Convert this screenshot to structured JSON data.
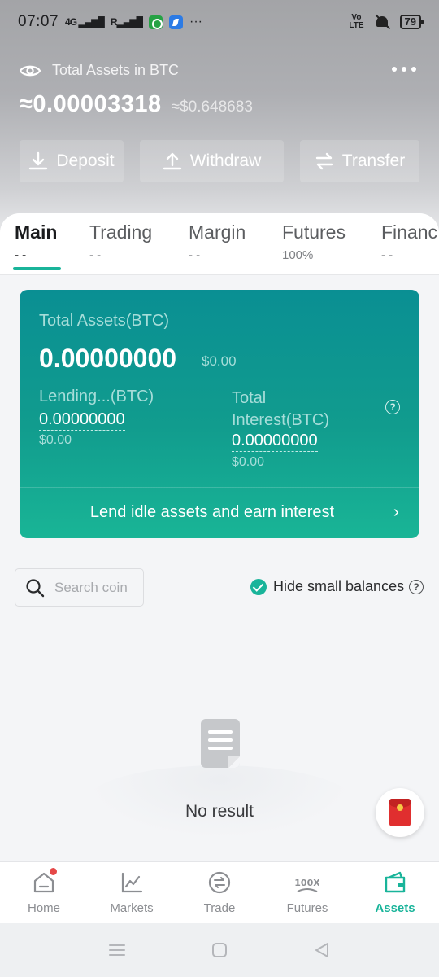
{
  "status_bar": {
    "time": "07:07",
    "signal1": "4G",
    "signal2": "R",
    "more": "···",
    "volte": "Vo LTE",
    "battery": "79"
  },
  "header": {
    "label": "Total Assets in BTC",
    "balance_btc": "≈0.00003318",
    "balance_usd": "≈$0.648683",
    "actions": [
      {
        "label": "Deposit",
        "icon": "download-icon"
      },
      {
        "label": "Withdraw",
        "icon": "upload-icon"
      },
      {
        "label": "Transfer",
        "icon": "transfer-icon"
      }
    ]
  },
  "tabs": [
    {
      "label": "Main",
      "sub": "- -",
      "active": true
    },
    {
      "label": "Trading",
      "sub": "- -"
    },
    {
      "label": "Margin",
      "sub": "- -"
    },
    {
      "label": "Futures",
      "sub": "100%"
    },
    {
      "label": "Financ",
      "sub": "- -"
    }
  ],
  "earn_card": {
    "title": "Total Assets(BTC)",
    "total_btc": "0.00000000",
    "total_usd": "$0.00",
    "lending_label": "Lending...(BTC)",
    "lending_value": "0.00000000",
    "lending_usd": "$0.00",
    "interest_label": "Total Interest(BTC)",
    "interest_value": "0.00000000",
    "interest_usd": "$0.00",
    "cta": "Lend idle assets and earn interest",
    "help": "?"
  },
  "filters": {
    "search_placeholder": "Search coin",
    "hide_small_label": "Hide small balances",
    "hide_small_checked": true,
    "help": "?"
  },
  "empty_state": {
    "text": "No result"
  },
  "bottom_nav": [
    {
      "label": "Home",
      "icon": "home-icon",
      "badge": true
    },
    {
      "label": "Markets",
      "icon": "chart-icon"
    },
    {
      "label": "Trade",
      "icon": "trade-icon"
    },
    {
      "label": "Futures",
      "icon": "futures-icon",
      "icon_text": "100X"
    },
    {
      "label": "Assets",
      "icon": "wallet-icon",
      "active": true
    }
  ],
  "colors": {
    "accent": "#19b49a",
    "card_top": "#0a8f93",
    "card_bottom": "#19b596"
  }
}
